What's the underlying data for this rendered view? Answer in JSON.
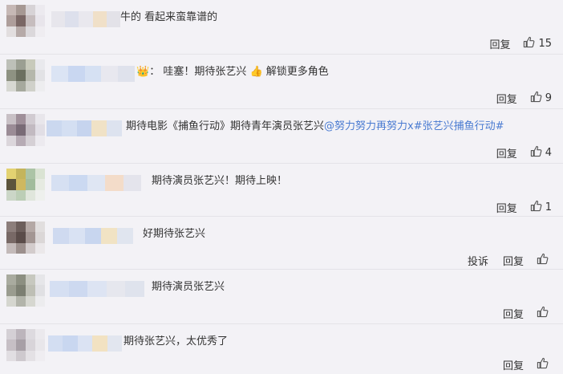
{
  "comments": [
    {
      "text": "牛的 看起来蛮靠谱的",
      "reply_label": "回复",
      "likes": "15",
      "avatar_colors": [
        "#c9b7b4",
        "#a99791",
        "#d8d3d6",
        "#eceaf0",
        "#b19d9a",
        "#7e6663",
        "#c8bcbe",
        "#e8e5ec",
        "#e3dedf",
        "#b8a9a7",
        "#dcd8dc",
        "#efedf2"
      ],
      "name_colors": [
        "#e7e6ec",
        "#dde0ec",
        "#e9e8ee",
        "#f0e0c8",
        "#e3e2e8"
      ]
    },
    {
      "text": "：  哇塞！期待张艺兴",
      "text2": "解锁更多角色",
      "reply_label": "回复",
      "likes": "9",
      "avatar_colors": [
        "#bdc0b6",
        "#9aa08f",
        "#c8cab8",
        "#e9e9ee",
        "#8d927f",
        "#6c705d",
        "#b5b7a8",
        "#e2e2e6",
        "#d7d8d1",
        "#a6a99a",
        "#d0d1c8",
        "#ededf0"
      ],
      "name_colors": [
        "#dbe4f4",
        "#c9d7f1",
        "#d6e1f3",
        "#e8e8ef",
        "#dfe2ec"
      ]
    },
    {
      "text": "期待电影《捕鱼行动》期待青年演员张艺兴",
      "mention": "@努力努力再努力x#张艺兴捕鱼行动#",
      "reply_label": "回复",
      "likes": "4",
      "avatar_colors": [
        "#c9bfc6",
        "#a28e9b",
        "#d2cbd2",
        "#e8e6ec",
        "#9e8b98",
        "#7b6a78",
        "#c4b9c2",
        "#e1dee6",
        "#dcd6dc",
        "#b8aab5",
        "#d6d0d6",
        "#eceaf0"
      ],
      "name_colors": [
        "#cbd8ef",
        "#d4dff2",
        "#c6d4ee",
        "#f0e2c6",
        "#dde3ef"
      ]
    },
    {
      "text": "期待演员张艺兴！期待上映！",
      "reply_label": "回复",
      "likes": "1",
      "avatar_colors": [
        "#e8d35a",
        "#c9b646",
        "#a8c6a0",
        "#d9e4d0",
        "#5e5436",
        "#d4b84a",
        "#9dbe96",
        "#e5eadf",
        "#c9d7c4",
        "#b9cfb1",
        "#dfe6da",
        "#eef0ec"
      ],
      "name_colors": [
        "#d6e0f2",
        "#cbd9f1",
        "#dfe6f3",
        "#f3dcc9",
        "#e4e4ec"
      ]
    },
    {
      "text": "好期待张艺兴",
      "report_label": "投诉",
      "reply_label": "回复",
      "likes": "",
      "avatar_colors": [
        "#8f7d7a",
        "#6f5d5a",
        "#b6a7a4",
        "#e2dede",
        "#7b6865",
        "#5d4b48",
        "#a69592",
        "#dcd7d7",
        "#c5bab8",
        "#9e8f8c",
        "#d4cccb",
        "#ebe8ea"
      ],
      "name_colors": [
        "#cfdaf0",
        "#d9e2f3",
        "#c8d6ef",
        "#f1e3c4",
        "#e0e5ef"
      ]
    },
    {
      "text": "期待演员张艺兴",
      "reply_label": "回复",
      "likes": "",
      "avatar_colors": [
        "#a9ab9c",
        "#8c8f7e",
        "#c7c8bd",
        "#e6e6ea",
        "#9a9c8c",
        "#7c7f6f",
        "#bebfb3",
        "#e0e0e4",
        "#d5d6ce",
        "#b2b4a8",
        "#d6d7cf",
        "#ececef"
      ],
      "name_colors": [
        "#d5dff2",
        "#cdd9f0",
        "#dde4f3",
        "#e6e7ee",
        "#dfe3ed"
      ]
    },
    {
      "text": "期待张艺兴，太优秀了",
      "reply_label": "回复",
      "likes": "",
      "avatar_colors": [
        "#d5d0d6",
        "#bdb5bd",
        "#dedae0",
        "#ebe9ee",
        "#c7bfc6",
        "#a89fa7",
        "#d9d4da",
        "#e8e6eb",
        "#e2dee3",
        "#cfc9cf",
        "#e4e1e6",
        "#efedf2"
      ],
      "name_colors": [
        "#d3def2",
        "#c9d7f0",
        "#dbe3f3",
        "#f2e2c2",
        "#e2e6ef"
      ]
    }
  ]
}
